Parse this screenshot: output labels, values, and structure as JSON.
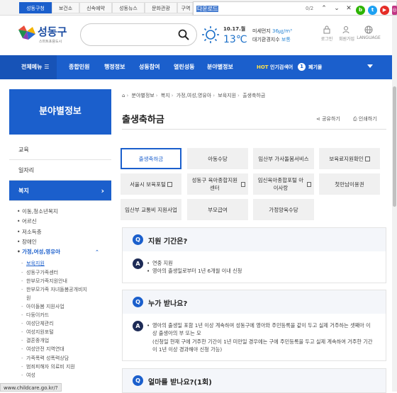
{
  "topbar": {
    "tabs": [
      "성동구청",
      "보건소",
      "신속예약",
      "성동뉴스",
      "문화관광",
      "구역"
    ],
    "find": {
      "query": "다운로드",
      "count": "0/2"
    },
    "sns": [
      {
        "name": "blog-icon",
        "glyph": "b",
        "color": "#2db400"
      },
      {
        "name": "twitter-icon",
        "glyph": "t",
        "color": "#1da1f2"
      },
      {
        "name": "youtube-icon",
        "glyph": "▶",
        "color": "#e52d27"
      },
      {
        "name": "instagram-icon",
        "glyph": "◎",
        "color": "#c13584"
      }
    ]
  },
  "header": {
    "logo_name": "성동구",
    "logo_sub": "스마트포용도시",
    "weather_date": "10.17.월",
    "weather_temp": "13℃",
    "dust_label": "미세먼지",
    "dust_value": "36㎍/m³",
    "air_label": "대기환경지수",
    "air_value": "보통",
    "utils": [
      "로그인",
      "회원가입",
      "LANGUAGE"
    ]
  },
  "gnb": {
    "all_label": "전체메뉴",
    "items": [
      "종합민원",
      "행정정보",
      "성동참여",
      "열린성동",
      "분야별정보"
    ],
    "hot_label": "HOT",
    "hot_suffix": "인기검색어",
    "rank": "1",
    "keyword": "폐기물"
  },
  "sidebar": {
    "title": "분야별정보",
    "items": [
      "교육",
      "일자리",
      "복지"
    ],
    "subs": [
      "이동,청소년복지",
      "어르신",
      "저소득층",
      "장애인",
      "가정,여성,영유아"
    ],
    "subsubs": [
      "보육지원",
      "성동구가족센터",
      "한부모가족지원안내",
      "한부모가족 자녀돌봄공개비지원",
      "아이돌봄 지원사업",
      "다둥이카드",
      "여성단체관리",
      "여성지원포털",
      "결혼중개업",
      "여성안전 지역연대",
      "가족폭력 성폭력상담",
      "범죄피해자 의료비 지원",
      "여성"
    ]
  },
  "main": {
    "breadcrumb": [
      "분야별정보",
      "복지",
      "가정,여성,영유아",
      "보육지원",
      "출생축하금"
    ],
    "title": "출생축하금",
    "share": "공유하기",
    "print": "인쇄하기",
    "tabs": [
      {
        "label": "출생축하금",
        "active": true,
        "ext": false
      },
      {
        "label": "아동수당",
        "active": false,
        "ext": false
      },
      {
        "label": "임산부 가사돌봄서비스",
        "active": false,
        "ext": false
      },
      {
        "label": "보육료지원확인",
        "active": false,
        "ext": true
      },
      {
        "label": "서울시 보육포털",
        "active": false,
        "ext": true
      },
      {
        "label": "성동구 육아종합지원센터",
        "active": false,
        "ext": true
      },
      {
        "label": "임신육아종합포털 아이사랑",
        "active": false,
        "ext": true
      },
      {
        "label": "첫만남이용권",
        "active": false,
        "ext": false
      },
      {
        "label": "임산부 교통비 지원사업",
        "active": false,
        "ext": false
      },
      {
        "label": "부모급여",
        "active": false,
        "ext": false
      },
      {
        "label": "가정양육수당",
        "active": false,
        "ext": false
      }
    ],
    "qa": [
      {
        "q": "지원 기간은?",
        "a": [
          "연중 지원",
          "영아의 출생일로부터 1년 6개월 이내 신청"
        ]
      },
      {
        "q": "누가 받나요?",
        "a": [
          "영아의 출생일 포함 1년 이상 계속하여 성동구에 영아와 주민등록을 같이 두고 실제 거주하는 셋째아 이상 출생아의 부 또는 모"
        ],
        "note": "(신청일 현재 구에 거주한 기간이 1년 미만일 경우에는 구에 주민등록을 두고 실제 계속하여 거주한 기간이 1년 이상 경과해야 신청 가능)"
      },
      {
        "q": "얼마를 받나요?(1회)",
        "a": []
      }
    ],
    "q_glyph": "Q",
    "a_glyph": "A"
  },
  "statusbar": {
    "url": "www.childcare.go.kr/?"
  }
}
